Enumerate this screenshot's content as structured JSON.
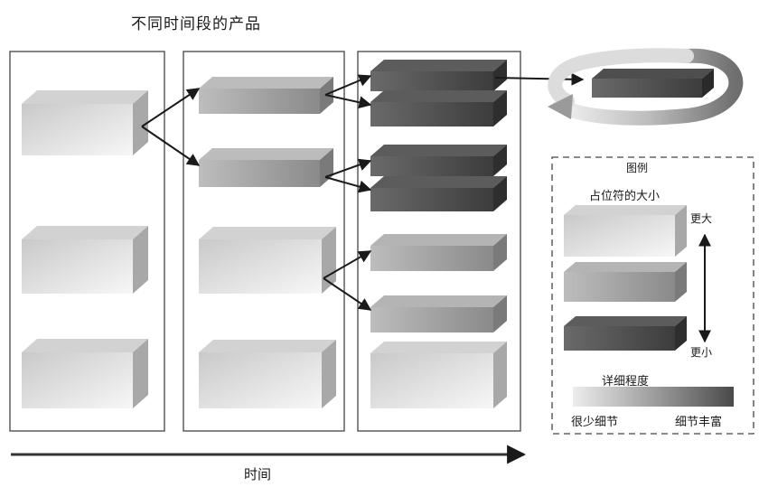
{
  "title": "不同时间段的产品",
  "time_axis_label": "时间",
  "legend": {
    "title": "图例",
    "size_title": "占位符的大小",
    "bigger": "更大",
    "smaller": "更小",
    "detail_title": "详细程度",
    "less_detail": "很少细节",
    "more_detail": "细节丰富"
  },
  "colors": {
    "light_block": "#d4d4d4",
    "medium_block": "#909090",
    "dark_block": "#4a4a4a",
    "frame": "#444444"
  }
}
